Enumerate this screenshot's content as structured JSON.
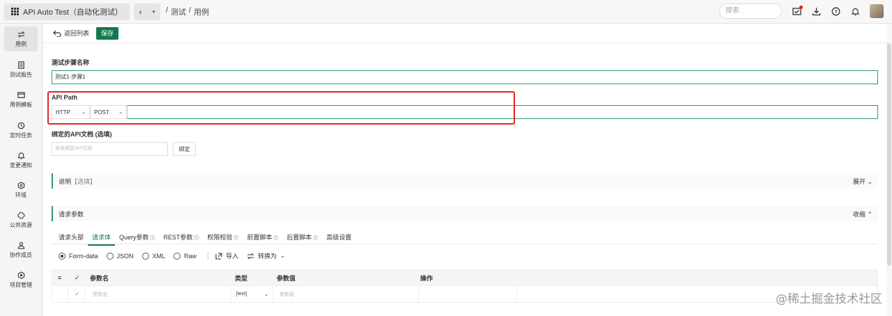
{
  "header": {
    "app_title": "API Auto Test（自动化测试）",
    "breadcrumb": [
      "/",
      "测试",
      "/",
      "用例"
    ],
    "search_placeholder": "搜索"
  },
  "sidebar": {
    "items": [
      {
        "label": "用例",
        "icon": "swap-icon",
        "active": true
      },
      {
        "label": "测试报告",
        "icon": "report-icon"
      },
      {
        "label": "用例模板",
        "icon": "template-icon"
      },
      {
        "label": "定时任务",
        "icon": "clock-icon"
      },
      {
        "label": "变更通知",
        "icon": "bell-icon"
      },
      {
        "label": "环境",
        "icon": "environment-icon"
      },
      {
        "label": "公共资源",
        "icon": "resource-icon"
      },
      {
        "label": "协作成员",
        "icon": "member-icon"
      },
      {
        "label": "项目管理",
        "icon": "settings-icon"
      }
    ]
  },
  "toolbar": {
    "back_label": "返回列表",
    "save_label": "保存"
  },
  "form": {
    "step_name_label": "测试步骤名称",
    "step_name_value": "测试1-步骤1",
    "api_path_label": "API Path",
    "protocol": "HTTP",
    "method": "POST",
    "path_value": "",
    "doc_label": "绑定的API文档 (选填)",
    "doc_placeholder": "尚未绑定API文档",
    "bind_label": "绑定"
  },
  "sections": {
    "description": {
      "label": "说明",
      "optional": "【选填】",
      "toggle": "展开"
    },
    "request_params": {
      "label": "请求参数",
      "toggle": "收缩"
    }
  },
  "tabs": [
    "请求头部",
    "请求体",
    "Query参数",
    "REST参数",
    "权限校验",
    "前置脚本",
    "后置脚本",
    "高级设置"
  ],
  "active_tab": "请求体",
  "body_types": [
    "Form-data",
    "JSON",
    "XML",
    "Raw"
  ],
  "selected_body_type": "Form-data",
  "body_actions": {
    "import": "导入",
    "convert": "转换为"
  },
  "table": {
    "headers": [
      "参数名",
      "类型",
      "参数值",
      "操作"
    ],
    "row": {
      "name_placeholder": "参数名",
      "type": "[text]",
      "value_placeholder": "参数值"
    }
  },
  "watermark": "@稀土掘金技术社区",
  "colors": {
    "accent": "#127a4e",
    "highlight_box": "#e02525"
  }
}
